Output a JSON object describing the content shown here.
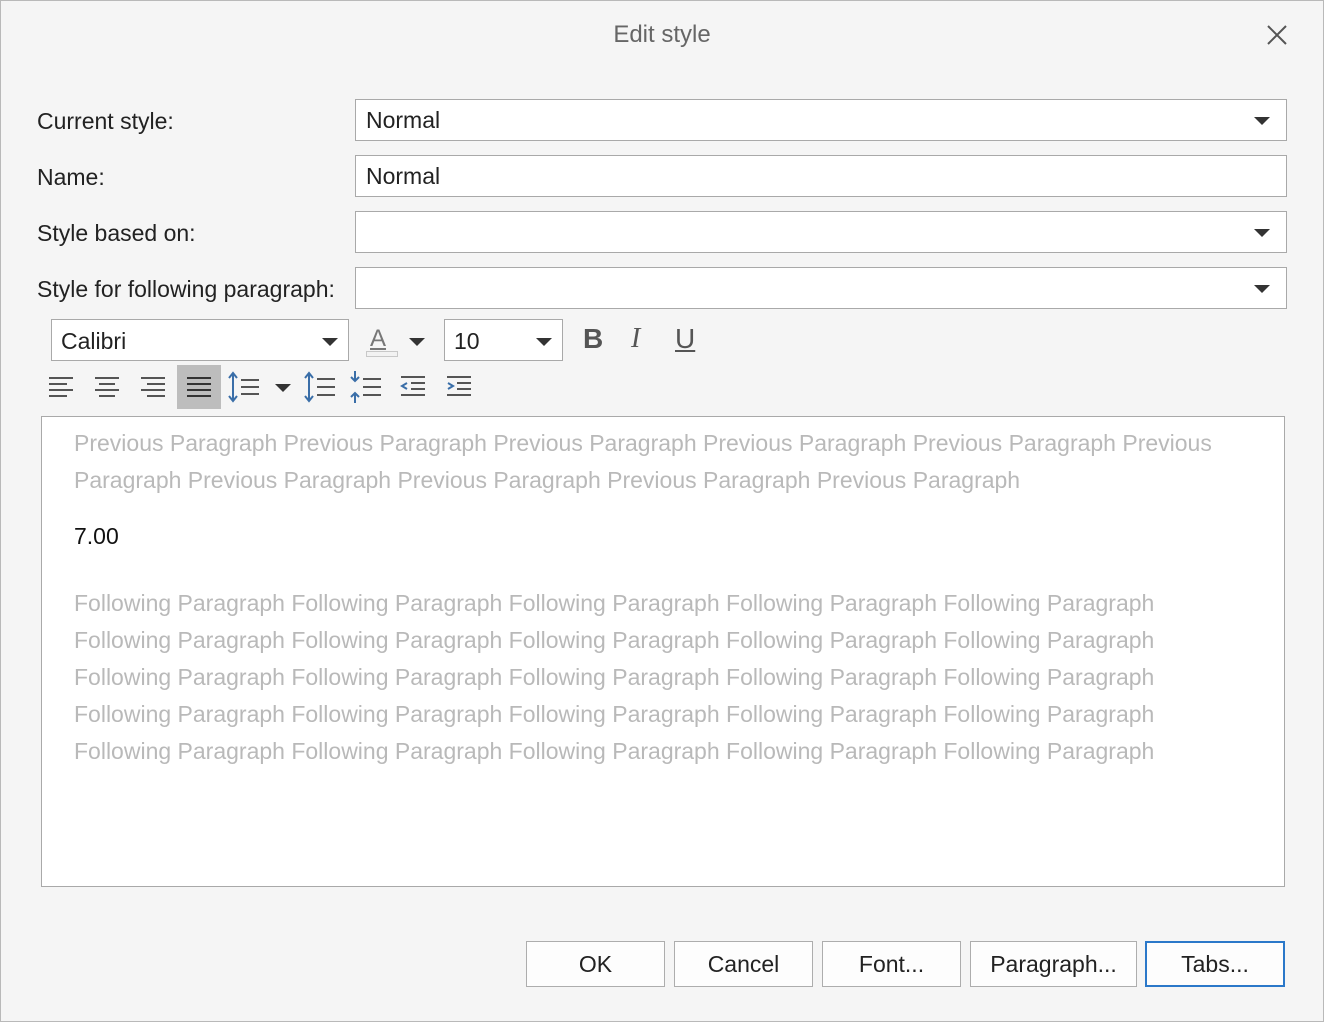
{
  "dialog": {
    "title": "Edit style",
    "close_icon": "close-icon"
  },
  "form": {
    "current_style": {
      "label": "Current style:",
      "value": "Normal"
    },
    "name": {
      "label": "Name:",
      "value": "Normal"
    },
    "based_on": {
      "label": "Style based on:",
      "value": ""
    },
    "following": {
      "label": "Style for following paragraph:",
      "value": ""
    }
  },
  "toolbar": {
    "font_family": "Calibri",
    "font_size": "10",
    "font_color_glyph": "A",
    "bold_glyph": "B",
    "italic_glyph": "I",
    "underline_glyph": "U",
    "alignment_selected": "justify",
    "colors": {
      "accent": "#2b78c9",
      "selected_bg": "#bdbdbd"
    }
  },
  "preview": {
    "previous_text": "Previous Paragraph Previous Paragraph Previous Paragraph Previous Paragraph Previous Paragraph Previous Paragraph Previous Paragraph Previous Paragraph Previous Paragraph Previous Paragraph",
    "current_text": "7.00",
    "following_text": "Following Paragraph Following Paragraph Following Paragraph Following Paragraph Following Paragraph Following Paragraph Following Paragraph Following Paragraph Following Paragraph Following Paragraph Following Paragraph Following Paragraph Following Paragraph Following Paragraph Following Paragraph Following Paragraph Following Paragraph Following Paragraph Following Paragraph Following Paragraph Following Paragraph Following Paragraph Following Paragraph Following Paragraph Following Paragraph"
  },
  "buttons": {
    "ok": "OK",
    "cancel": "Cancel",
    "font": "Font...",
    "paragraph": "Paragraph...",
    "tabs": "Tabs..."
  }
}
